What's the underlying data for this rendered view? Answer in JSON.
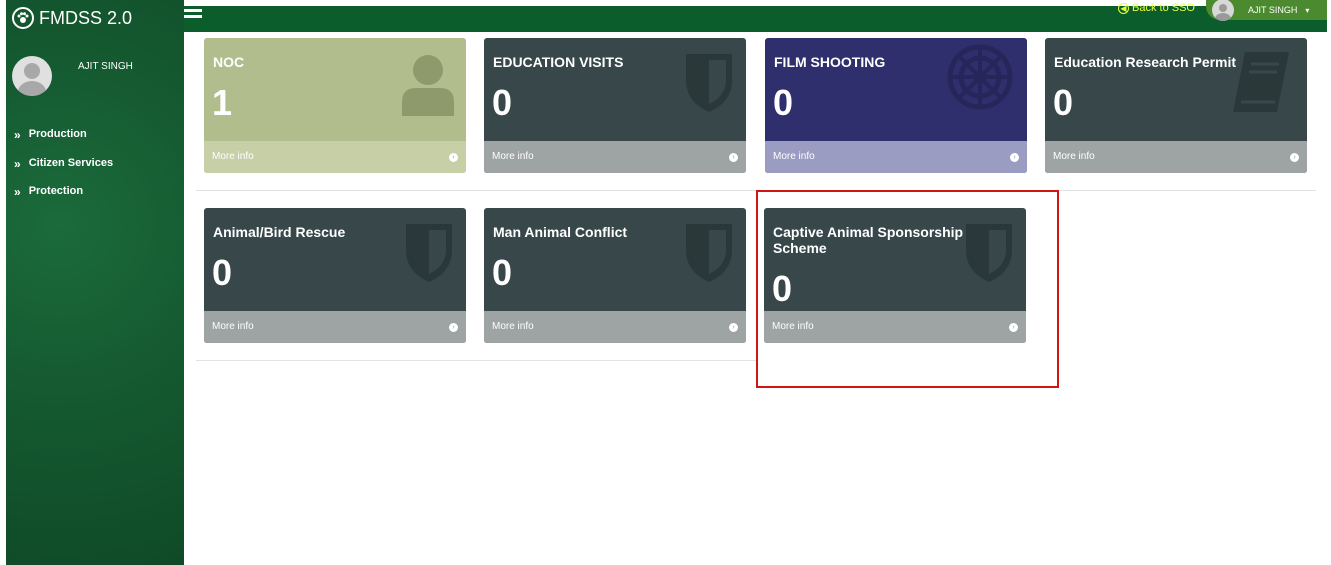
{
  "app": {
    "title": "FMDSS 2.0",
    "logo_icon": "paw-icon"
  },
  "user": {
    "name": "AJIT SINGH"
  },
  "sidebar": {
    "items": [
      {
        "label": "Production"
      },
      {
        "label": "Citizen Services"
      },
      {
        "label": "Protection"
      }
    ]
  },
  "topbar": {
    "back_to_sso": "Back to SSO",
    "user_name": "AJIT SINGH",
    "caret": "▾"
  },
  "cards": [
    {
      "title": "NOC",
      "count": "1",
      "more": "More info",
      "color": "#b2bd8e",
      "footer_color": "#c6cfa6",
      "icon": "user-icon"
    },
    {
      "title": "EDUCATION VISITS",
      "count": "0",
      "more": "More info",
      "color": "#37474a",
      "footer_color": "#9ea3a4",
      "icon": "shield-icon"
    },
    {
      "title": "FILM SHOOTING",
      "count": "0",
      "more": "More info",
      "color": "#2f2f6d",
      "footer_color": "#9a9cc1",
      "icon": "empire-icon"
    },
    {
      "title": "Education Research Permit",
      "count": "0",
      "more": "More info",
      "color": "#37474a",
      "footer_color": "#9ea3a4",
      "icon": "book-icon"
    },
    {
      "title": "Animal/Bird Rescue",
      "count": "0",
      "more": "More info",
      "color": "#37474a",
      "footer_color": "#9ea3a4",
      "icon": "shield-icon"
    },
    {
      "title": "Man Animal Conflict",
      "count": "0",
      "more": "More info",
      "color": "#37474a",
      "footer_color": "#9ea3a4",
      "icon": "shield-icon"
    },
    {
      "title": "Captive Animal Sponsorship Scheme",
      "count": "0",
      "more": "More info",
      "color": "#37474a",
      "footer_color": "#9ea3a4",
      "icon": "shield-icon"
    }
  ],
  "colors": {
    "sidebar": "#155a31",
    "topbar": "#0b5e2c",
    "highlight": "#d01515",
    "back_to_sso": "#e6ff40"
  }
}
